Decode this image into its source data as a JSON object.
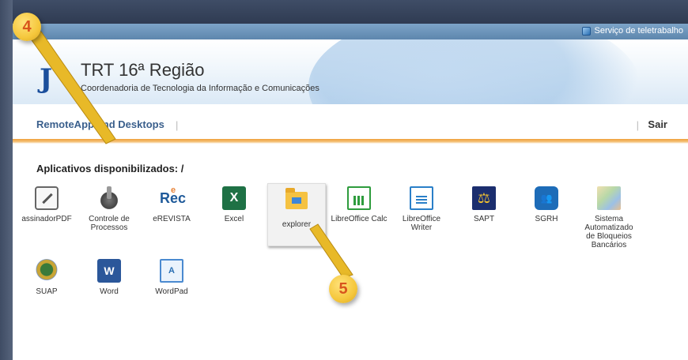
{
  "top_bar": {
    "telework_label": "Serviço de teletrabalho"
  },
  "banner": {
    "logo_text": "J",
    "title": "TRT 16ª Região",
    "subtitle": "Coordenadoria de Tecnologia da Informação e Comunicações"
  },
  "nav": {
    "remote_label": "RemoteApp and Desktops",
    "separator": "|",
    "signout_label": "Sair"
  },
  "content": {
    "heading": "Aplicativos disponibilizados: /",
    "apps": [
      {
        "label": "assinadorPDF",
        "icon": "pdf-signer-icon"
      },
      {
        "label": "Controle de Processos",
        "icon": "satellite-icon"
      },
      {
        "label": "eREVISTA",
        "icon": "erec-icon"
      },
      {
        "label": "Excel",
        "icon": "excel-icon"
      },
      {
        "label": "explorer",
        "icon": "folder-icon"
      },
      {
        "label": "LibreOffice Calc",
        "icon": "libreoffice-calc-icon"
      },
      {
        "label": "LibreOffice Writer",
        "icon": "libreoffice-writer-icon"
      },
      {
        "label": "SAPT",
        "icon": "scales-icon"
      },
      {
        "label": "SGRH",
        "icon": "people-icon"
      },
      {
        "label": "Sistema Automatizado de Bloqueios Bancários",
        "icon": "map-icon"
      },
      {
        "label": "SUAP",
        "icon": "coat-of-arms-icon"
      },
      {
        "label": "Word",
        "icon": "word-icon"
      },
      {
        "label": "WordPad",
        "icon": "wordpad-icon"
      }
    ]
  },
  "annotations": {
    "step4": "4",
    "step5": "5"
  },
  "colors": {
    "accent_orange": "#f0a03a",
    "nav_blue": "#3a5f8c",
    "marker_yellow": "#f5c73c",
    "marker_text": "#d8541d"
  }
}
